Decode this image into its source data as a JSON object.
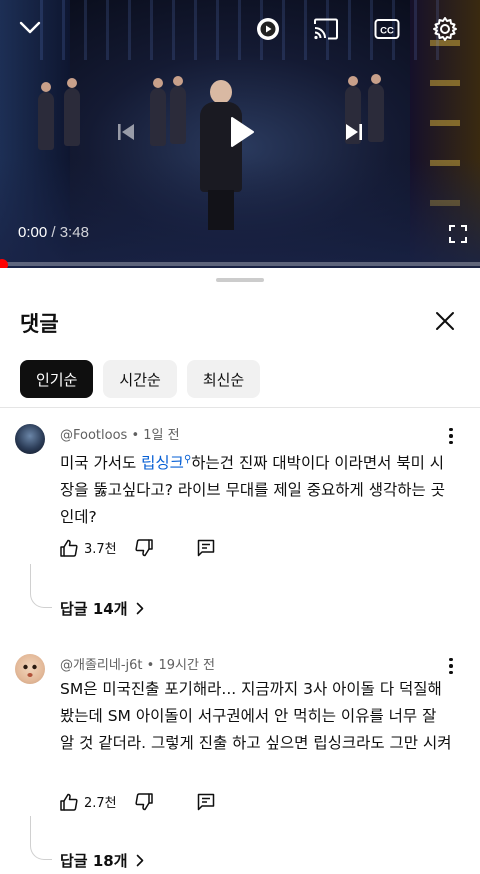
{
  "player": {
    "current_time": "0:00",
    "separator": " / ",
    "duration": "3:48",
    "progress": 0,
    "accent": "#ff0000",
    "icons": [
      "chevron-down-icon",
      "autoplay-icon",
      "cast-icon",
      "captions-icon",
      "settings-icon",
      "previous-icon",
      "play-icon",
      "next-icon",
      "fullscreen-icon"
    ]
  },
  "sheet": {
    "title": "댓글",
    "close_icon": "close-icon",
    "chips": [
      "인기순",
      "시간순",
      "최신순"
    ]
  },
  "comments": [
    {
      "handle": "@Footloos",
      "time": "1일 전",
      "text_before": "미국 가서도 ",
      "link_text": "립싱크",
      "text_after": "하는건 진짜 대박이다 이라면서 북미 시장을 뚫고싶다고? 라이브 무대를 제일 중요하게 생각하는 곳인데?",
      "likes": "3.7천",
      "replies": "답글 14개"
    },
    {
      "handle": "@개졸리네-j6t",
      "time": "19시간 전",
      "text": "SM은 미국진출 포기해라... 지금까지 3사 아이돌 다 덕질해봤는데 SM 아이돌이 서구권에서 안 먹히는 이유를 너무 잘 알 것 같더라. 그렇게 진출 하고 싶으면 립싱크라도 그만 시켜",
      "likes": "2.7천",
      "replies": "답글 18개"
    }
  ],
  "meta_separator": " • "
}
